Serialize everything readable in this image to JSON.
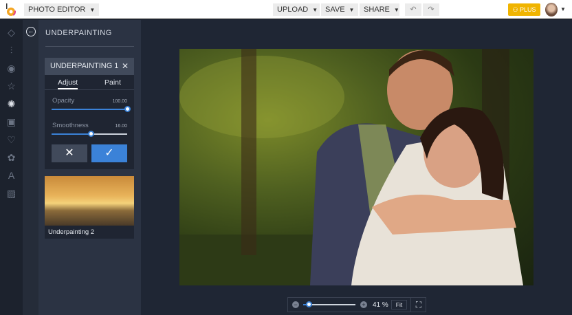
{
  "topbar": {
    "app_menu": "PHOTO EDITOR",
    "upload": "UPLOAD",
    "save": "SAVE",
    "share": "SHARE",
    "plus": "PLUS"
  },
  "rail_icons": [
    "layers-icon",
    "sliders-icon",
    "eye-icon",
    "star-icon",
    "effects-icon",
    "frame-icon",
    "heart-icon",
    "badge-icon",
    "text-icon",
    "texture-icon"
  ],
  "panel": {
    "title": "UNDERPAINTING",
    "card": {
      "title": "UNDERPAINTING 1",
      "tabs": [
        "Adjust",
        "Paint"
      ],
      "sliders": [
        {
          "label": "Opacity",
          "value": "100.00",
          "fraction": 1.0
        },
        {
          "label": "Smoothness",
          "value": "16.00",
          "fraction": 0.52
        }
      ]
    },
    "preset": {
      "label": "Underpainting 2"
    }
  },
  "zoom": {
    "value": "41 %",
    "fit": "Fit",
    "fraction": 0.1
  },
  "colors": {
    "accent": "#3b82d8",
    "plus": "#f0b400"
  }
}
